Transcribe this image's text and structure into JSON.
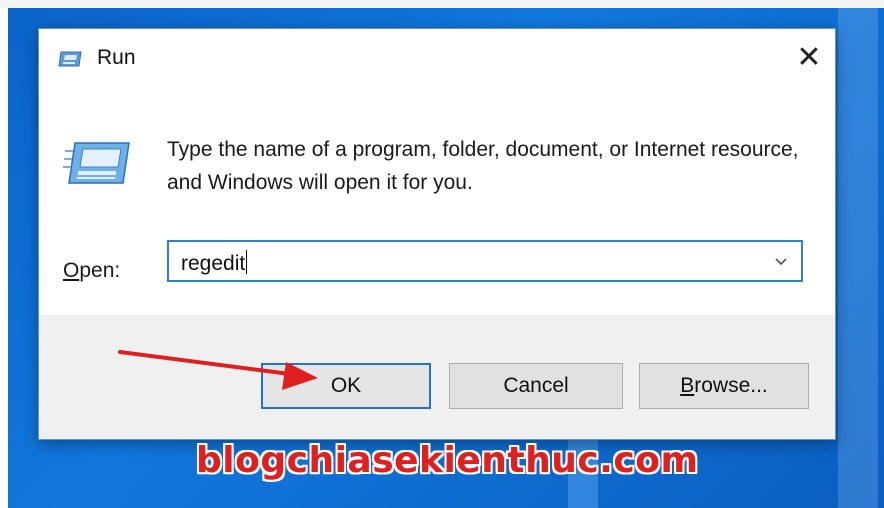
{
  "window": {
    "title": "Run",
    "title_icon": "run-icon",
    "close_glyph": "✕"
  },
  "dialog": {
    "icon": "run-icon",
    "description": "Type the name of a program, folder, document, or Internet resource, and Windows will open it for you.",
    "open_label_accel": "O",
    "open_label_rest": "pen:",
    "open_value": "regedit",
    "dropdown_icon": "chevron-down-icon"
  },
  "buttons": {
    "ok": "OK",
    "cancel": "Cancel",
    "browse_accel": "B",
    "browse_rest": "rowse..."
  },
  "annotation": {
    "arrow_color": "#e02020",
    "watermark": "blogchiasekienthuc.com"
  },
  "colors": {
    "accent": "#2672c9",
    "desktop": "#0a63c9",
    "footer": "#f0f0f0"
  }
}
